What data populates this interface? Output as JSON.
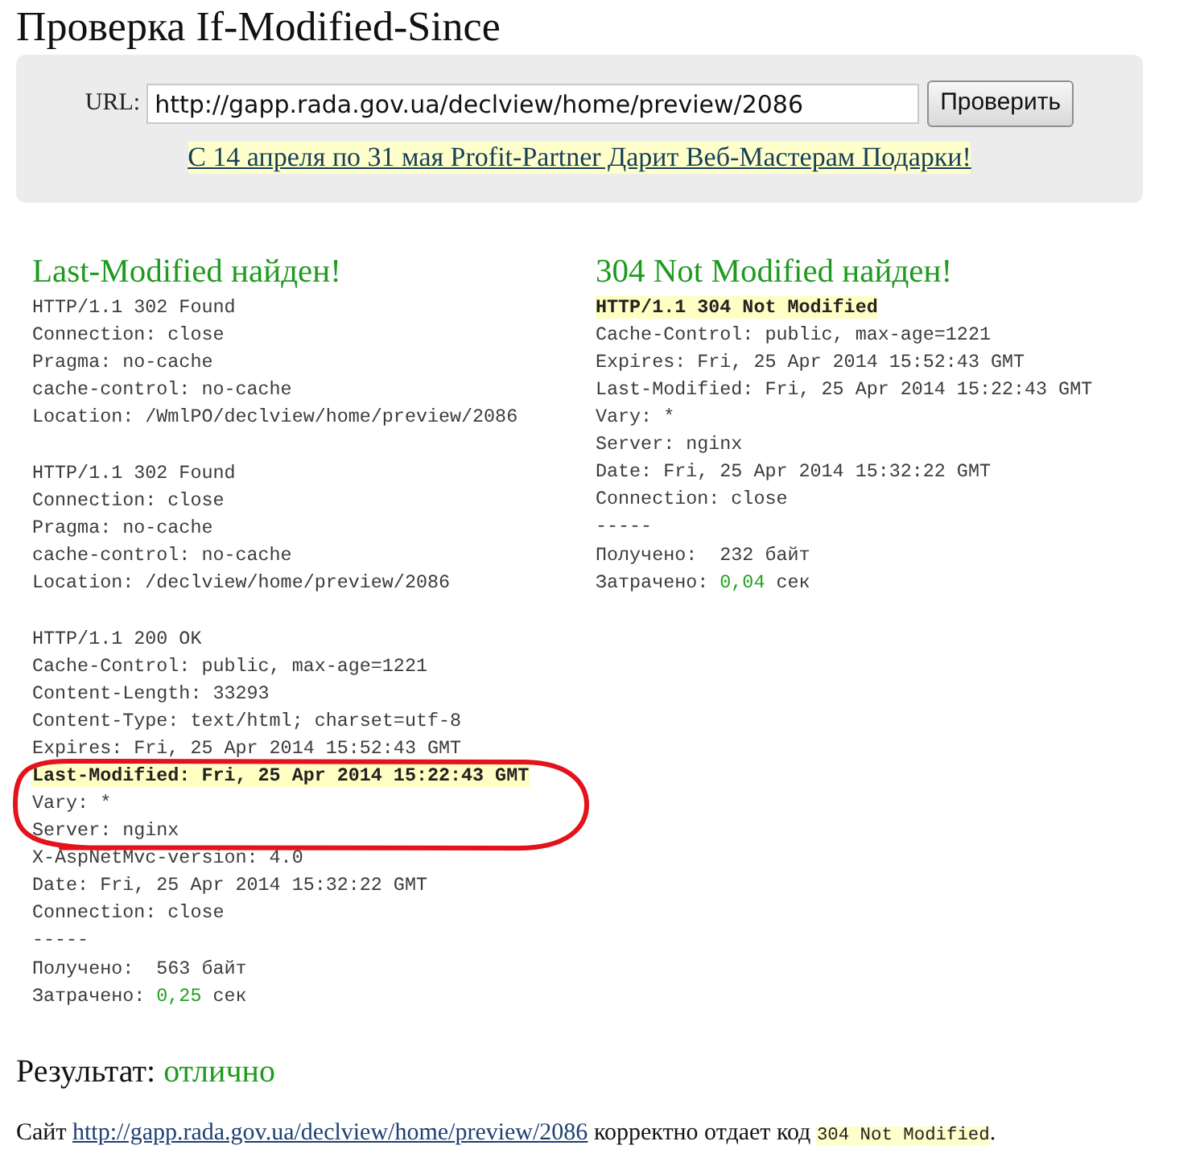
{
  "page": {
    "title": "Проверка If-Modified-Since"
  },
  "form": {
    "url_label": "URL:",
    "url_value": "http://gapp.rada.gov.ua/declview/home/preview/2086",
    "submit_button": "Проверить",
    "promo_link": "С 14 апреля по 31 мая Profit-Partner Дарит Веб-Мастерам Подарки!"
  },
  "panels": [
    {
      "title": "Last-Modified найден!",
      "responses": [
        {
          "lines": [
            {
              "text": "HTTP/1.1 302 Found",
              "highlighted": false,
              "circled": false
            },
            {
              "text": "Connection: close",
              "highlighted": false,
              "circled": false
            },
            {
              "text": "Pragma: no-cache",
              "highlighted": false,
              "circled": false
            },
            {
              "text": "cache-control: no-cache",
              "highlighted": false,
              "circled": false
            },
            {
              "text": "Location: /WmlPO/declview/home/preview/2086",
              "highlighted": false,
              "circled": false
            }
          ]
        },
        {
          "lines": [
            {
              "text": "HTTP/1.1 302 Found",
              "highlighted": false,
              "circled": false
            },
            {
              "text": "Connection: close",
              "highlighted": false,
              "circled": false
            },
            {
              "text": "Pragma: no-cache",
              "highlighted": false,
              "circled": false
            },
            {
              "text": "cache-control: no-cache",
              "highlighted": false,
              "circled": false
            },
            {
              "text": "Location: /declview/home/preview/2086",
              "highlighted": false,
              "circled": false
            }
          ]
        },
        {
          "lines": [
            {
              "text": "HTTP/1.1 200 OK",
              "highlighted": false,
              "circled": false
            },
            {
              "text": "Cache-Control: public, max-age=1221",
              "highlighted": false,
              "circled": false
            },
            {
              "text": "Content-Length: 33293",
              "highlighted": false,
              "circled": false
            },
            {
              "text": "Content-Type: text/html; charset=utf-8",
              "highlighted": false,
              "circled": false
            },
            {
              "text": "Expires: Fri, 25 Apr 2014 15:52:43 GMT",
              "highlighted": false,
              "circled": false
            },
            {
              "text": "Last-Modified: Fri, 25 Apr 2014 15:22:43 GMT",
              "highlighted": true,
              "circled": true
            },
            {
              "text": "Vary: *",
              "highlighted": false,
              "circled": true
            },
            {
              "text": "Server: nginx",
              "highlighted": false,
              "circled": true
            },
            {
              "text": "X-AspNetMvc-version: 4.0",
              "highlighted": false,
              "circled": false
            },
            {
              "text": "Date: Fri, 25 Apr 2014 15:32:22 GMT",
              "highlighted": false,
              "circled": false
            },
            {
              "text": "Connection: close",
              "highlighted": false,
              "circled": false
            }
          ]
        }
      ],
      "separator": "-----",
      "received": "Получено:  563 байт",
      "spent": {
        "label": "Затрачено:",
        "value": "0,25",
        "unit": "сек"
      }
    },
    {
      "title": "304 Not Modified найден!",
      "responses": [
        {
          "lines": [
            {
              "text": "HTTP/1.1 304 Not Modified",
              "highlighted": true,
              "circled": false
            },
            {
              "text": "Cache-Control: public, max-age=1221",
              "highlighted": false,
              "circled": false
            },
            {
              "text": "Expires: Fri, 25 Apr 2014 15:52:43 GMT",
              "highlighted": false,
              "circled": false
            },
            {
              "text": "Last-Modified: Fri, 25 Apr 2014 15:22:43 GMT",
              "highlighted": false,
              "circled": false
            },
            {
              "text": "Vary: *",
              "highlighted": false,
              "circled": false
            },
            {
              "text": "Server: nginx",
              "highlighted": false,
              "circled": false
            },
            {
              "text": "Date: Fri, 25 Apr 2014 15:32:22 GMT",
              "highlighted": false,
              "circled": false
            },
            {
              "text": "Connection: close",
              "highlighted": false,
              "circled": false
            }
          ]
        }
      ],
      "separator": "-----",
      "received": "Получено:  232 байт",
      "spent": {
        "label": "Затрачено:",
        "value": "0,04",
        "unit": "сек"
      }
    }
  ],
  "result": {
    "label": "Результат:",
    "value": "отлично"
  },
  "summary": {
    "prefix": "Сайт",
    "link": "http://gapp.rada.gov.ua/declview/home/preview/2086",
    "middle": "корректно отдает код",
    "code": "304 Not Modified",
    "suffix": "."
  }
}
